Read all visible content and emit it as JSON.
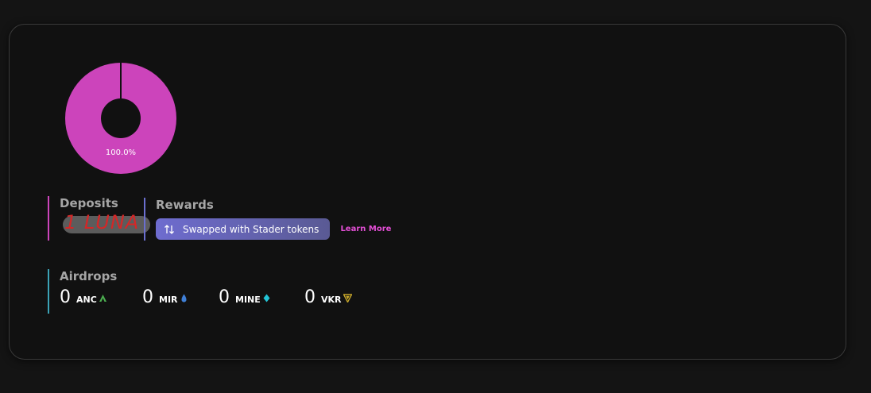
{
  "chart_data": {
    "type": "pie",
    "categories": [
      "Deposits"
    ],
    "values": [
      100.0
    ],
    "data_labels": [
      "100.0%"
    ],
    "colors": [
      "#cc44bb"
    ],
    "hole": true
  },
  "deposits": {
    "title": "Deposits",
    "value": "1 LUNA",
    "accent": "#cc44bb"
  },
  "rewards": {
    "title": "Rewards",
    "pill_icon": "swap-arrows-icon",
    "pill_label": "Swapped with Stader tokens",
    "learn_more": "Learn More",
    "accent": "#6b6fcf"
  },
  "airdrops": {
    "title": "Airdrops",
    "accent": "#3ba3b6",
    "items": [
      {
        "amount": "0",
        "symbol": "ANC",
        "icon": "anc-token-icon",
        "color": "#4caf50"
      },
      {
        "amount": "0",
        "symbol": "MIR",
        "icon": "mir-token-icon",
        "color": "#3f7fd6"
      },
      {
        "amount": "0",
        "symbol": "MINE",
        "icon": "mine-token-icon",
        "color": "#22c4d6"
      },
      {
        "amount": "0",
        "symbol": "VKR",
        "icon": "vkr-token-icon",
        "color": "#c6a62a"
      }
    ]
  }
}
